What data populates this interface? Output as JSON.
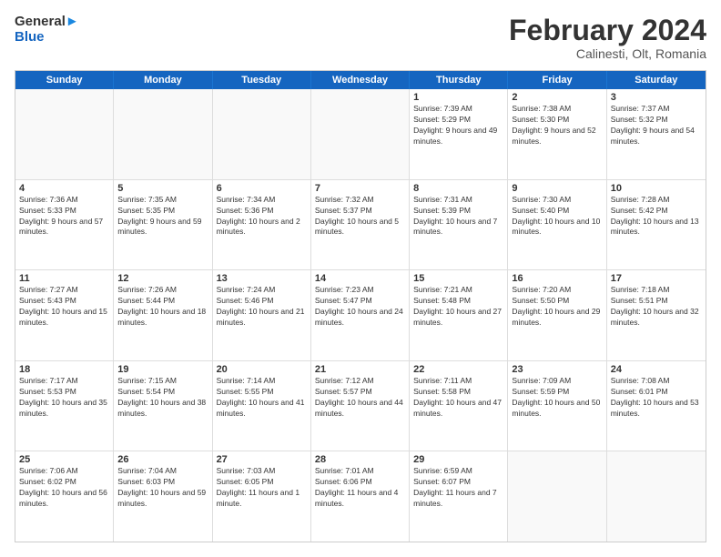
{
  "logo": {
    "general": "General",
    "blue": "Blue"
  },
  "header": {
    "month": "February 2024",
    "location": "Calinesti, Olt, Romania"
  },
  "days_of_week": [
    "Sunday",
    "Monday",
    "Tuesday",
    "Wednesday",
    "Thursday",
    "Friday",
    "Saturday"
  ],
  "weeks": [
    [
      {
        "day": "",
        "content": ""
      },
      {
        "day": "",
        "content": ""
      },
      {
        "day": "",
        "content": ""
      },
      {
        "day": "",
        "content": ""
      },
      {
        "day": "1",
        "content": "Sunrise: 7:39 AM\nSunset: 5:29 PM\nDaylight: 9 hours and 49 minutes."
      },
      {
        "day": "2",
        "content": "Sunrise: 7:38 AM\nSunset: 5:30 PM\nDaylight: 9 hours and 52 minutes."
      },
      {
        "day": "3",
        "content": "Sunrise: 7:37 AM\nSunset: 5:32 PM\nDaylight: 9 hours and 54 minutes."
      }
    ],
    [
      {
        "day": "4",
        "content": "Sunrise: 7:36 AM\nSunset: 5:33 PM\nDaylight: 9 hours and 57 minutes."
      },
      {
        "day": "5",
        "content": "Sunrise: 7:35 AM\nSunset: 5:35 PM\nDaylight: 9 hours and 59 minutes."
      },
      {
        "day": "6",
        "content": "Sunrise: 7:34 AM\nSunset: 5:36 PM\nDaylight: 10 hours and 2 minutes."
      },
      {
        "day": "7",
        "content": "Sunrise: 7:32 AM\nSunset: 5:37 PM\nDaylight: 10 hours and 5 minutes."
      },
      {
        "day": "8",
        "content": "Sunrise: 7:31 AM\nSunset: 5:39 PM\nDaylight: 10 hours and 7 minutes."
      },
      {
        "day": "9",
        "content": "Sunrise: 7:30 AM\nSunset: 5:40 PM\nDaylight: 10 hours and 10 minutes."
      },
      {
        "day": "10",
        "content": "Sunrise: 7:28 AM\nSunset: 5:42 PM\nDaylight: 10 hours and 13 minutes."
      }
    ],
    [
      {
        "day": "11",
        "content": "Sunrise: 7:27 AM\nSunset: 5:43 PM\nDaylight: 10 hours and 15 minutes."
      },
      {
        "day": "12",
        "content": "Sunrise: 7:26 AM\nSunset: 5:44 PM\nDaylight: 10 hours and 18 minutes."
      },
      {
        "day": "13",
        "content": "Sunrise: 7:24 AM\nSunset: 5:46 PM\nDaylight: 10 hours and 21 minutes."
      },
      {
        "day": "14",
        "content": "Sunrise: 7:23 AM\nSunset: 5:47 PM\nDaylight: 10 hours and 24 minutes."
      },
      {
        "day": "15",
        "content": "Sunrise: 7:21 AM\nSunset: 5:48 PM\nDaylight: 10 hours and 27 minutes."
      },
      {
        "day": "16",
        "content": "Sunrise: 7:20 AM\nSunset: 5:50 PM\nDaylight: 10 hours and 29 minutes."
      },
      {
        "day": "17",
        "content": "Sunrise: 7:18 AM\nSunset: 5:51 PM\nDaylight: 10 hours and 32 minutes."
      }
    ],
    [
      {
        "day": "18",
        "content": "Sunrise: 7:17 AM\nSunset: 5:53 PM\nDaylight: 10 hours and 35 minutes."
      },
      {
        "day": "19",
        "content": "Sunrise: 7:15 AM\nSunset: 5:54 PM\nDaylight: 10 hours and 38 minutes."
      },
      {
        "day": "20",
        "content": "Sunrise: 7:14 AM\nSunset: 5:55 PM\nDaylight: 10 hours and 41 minutes."
      },
      {
        "day": "21",
        "content": "Sunrise: 7:12 AM\nSunset: 5:57 PM\nDaylight: 10 hours and 44 minutes."
      },
      {
        "day": "22",
        "content": "Sunrise: 7:11 AM\nSunset: 5:58 PM\nDaylight: 10 hours and 47 minutes."
      },
      {
        "day": "23",
        "content": "Sunrise: 7:09 AM\nSunset: 5:59 PM\nDaylight: 10 hours and 50 minutes."
      },
      {
        "day": "24",
        "content": "Sunrise: 7:08 AM\nSunset: 6:01 PM\nDaylight: 10 hours and 53 minutes."
      }
    ],
    [
      {
        "day": "25",
        "content": "Sunrise: 7:06 AM\nSunset: 6:02 PM\nDaylight: 10 hours and 56 minutes."
      },
      {
        "day": "26",
        "content": "Sunrise: 7:04 AM\nSunset: 6:03 PM\nDaylight: 10 hours and 59 minutes."
      },
      {
        "day": "27",
        "content": "Sunrise: 7:03 AM\nSunset: 6:05 PM\nDaylight: 11 hours and 1 minute."
      },
      {
        "day": "28",
        "content": "Sunrise: 7:01 AM\nSunset: 6:06 PM\nDaylight: 11 hours and 4 minutes."
      },
      {
        "day": "29",
        "content": "Sunrise: 6:59 AM\nSunset: 6:07 PM\nDaylight: 11 hours and 7 minutes."
      },
      {
        "day": "",
        "content": ""
      },
      {
        "day": "",
        "content": ""
      }
    ]
  ]
}
